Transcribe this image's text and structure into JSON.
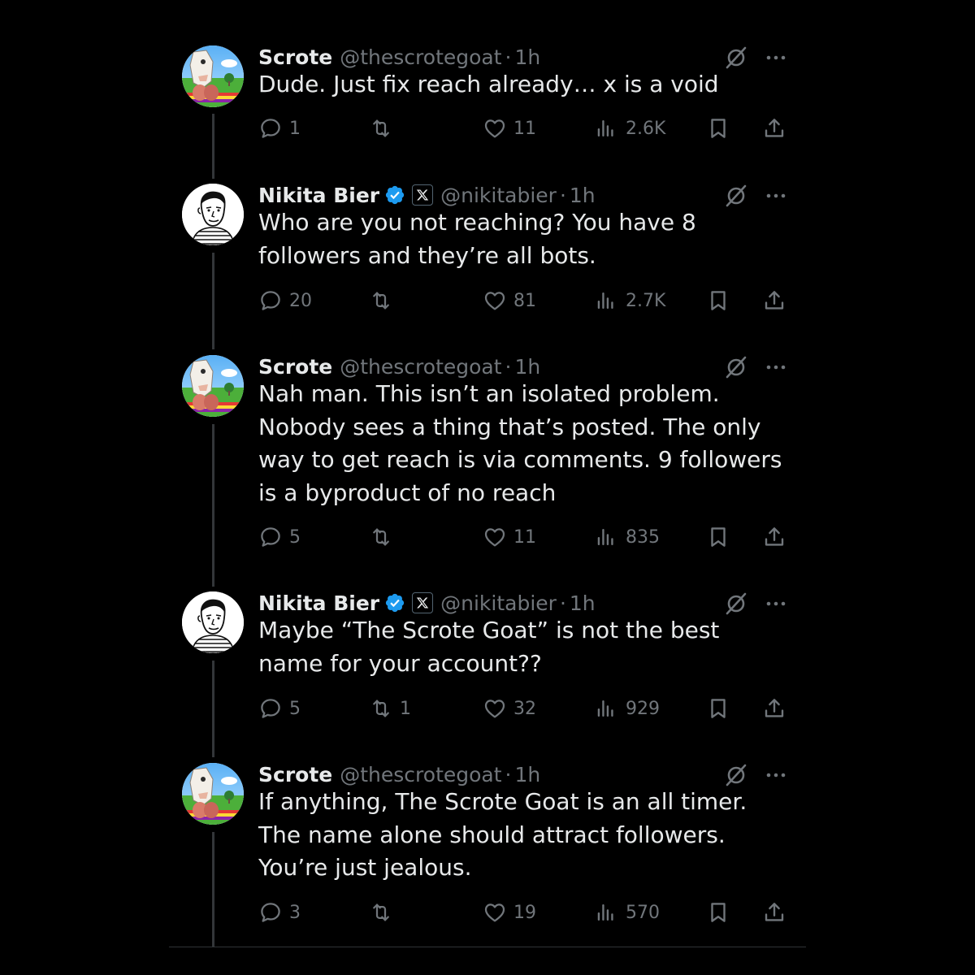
{
  "colors": {
    "background": "#000000",
    "text_primary": "#e7e9ea",
    "text_secondary": "#71767b",
    "verified_blue": "#1d9bf0",
    "divider": "#2f3336"
  },
  "tweets": [
    {
      "author": "Scrote",
      "handle": "@thescrotegoat",
      "separator": "·",
      "time": "1h",
      "verified": false,
      "avatar": "goat-avatar",
      "text": "Dude. Just fix reach already… x is a void",
      "replies": "1",
      "reposts": "",
      "likes": "11",
      "views": "2.6K"
    },
    {
      "author": "Nikita Bier",
      "handle": "@nikitabier",
      "separator": "·",
      "time": "1h",
      "verified": true,
      "avatar": "sketch-avatar",
      "text": "Who are you not reaching? You have 8 followers and they’re all bots.",
      "replies": "20",
      "reposts": "",
      "likes": "81",
      "views": "2.7K"
    },
    {
      "author": "Scrote",
      "handle": "@thescrotegoat",
      "separator": "·",
      "time": "1h",
      "verified": false,
      "avatar": "goat-avatar",
      "text": "Nah man. This isn’t an isolated problem. Nobody sees a thing that’s posted. The only way to get reach is via comments. 9 followers is a byproduct of no reach",
      "replies": "5",
      "reposts": "",
      "likes": "11",
      "views": "835"
    },
    {
      "author": "Nikita Bier",
      "handle": "@nikitabier",
      "separator": "·",
      "time": "1h",
      "verified": true,
      "avatar": "sketch-avatar",
      "text": "Maybe “The Scrote Goat” is not the best name for your account??",
      "replies": "5",
      "reposts": "1",
      "likes": "32",
      "views": "929"
    },
    {
      "author": "Scrote",
      "handle": "@thescrotegoat",
      "separator": "·",
      "time": "1h",
      "verified": false,
      "avatar": "goat-avatar",
      "text": "If anything, The Scrote Goat is an all timer. The name alone should attract followers. You’re just jealous.",
      "replies": "3",
      "reposts": "",
      "likes": "19",
      "views": "570"
    }
  ]
}
